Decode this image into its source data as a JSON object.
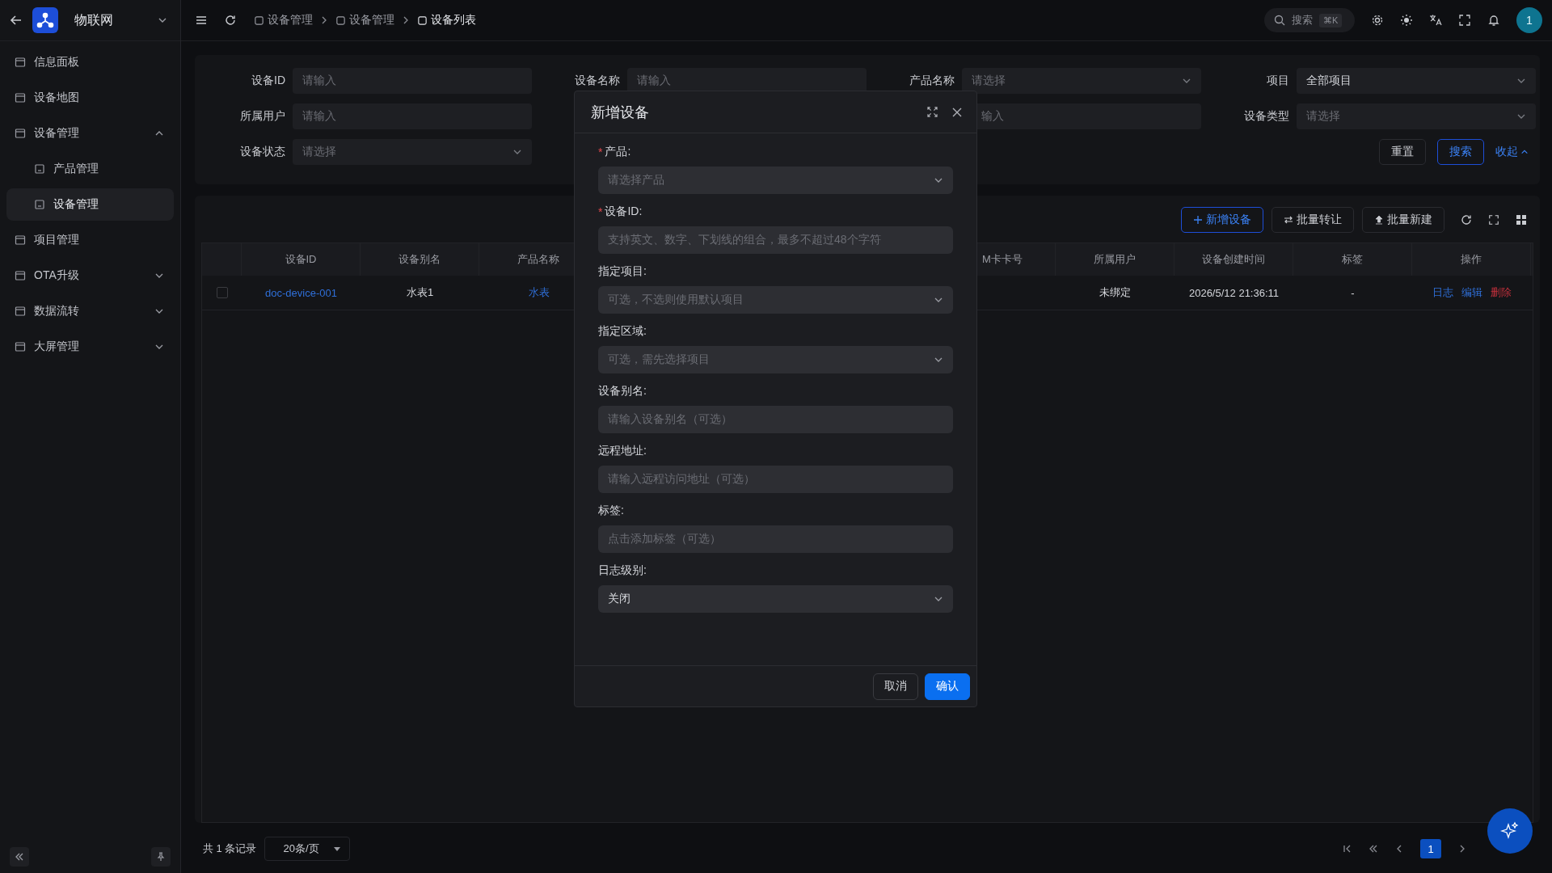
{
  "app": {
    "title": "物联网"
  },
  "breadcrumbs": [
    {
      "label": "设备管理"
    },
    {
      "label": "设备管理"
    },
    {
      "label": "设备列表"
    }
  ],
  "search": {
    "placeholder": "搜索",
    "shortcut": "⌘K"
  },
  "user": {
    "avatar": "1"
  },
  "sidebar": {
    "items": [
      {
        "label": "信息面板",
        "kind": "link",
        "selected": false
      },
      {
        "label": "设备地图",
        "kind": "link",
        "selected": false
      },
      {
        "label": "设备管理",
        "kind": "group",
        "expanded": true,
        "selected": false,
        "children": [
          {
            "label": "产品管理",
            "selected": false
          },
          {
            "label": "设备管理",
            "selected": true
          }
        ]
      },
      {
        "label": "项目管理",
        "kind": "link",
        "selected": false
      },
      {
        "label": "OTA升级",
        "kind": "group",
        "expanded": false,
        "selected": false
      },
      {
        "label": "数据流转",
        "kind": "group",
        "expanded": false,
        "selected": false
      },
      {
        "label": "大屏管理",
        "kind": "group",
        "expanded": false,
        "selected": false
      }
    ]
  },
  "filters": [
    {
      "kind": "input",
      "label": "设备ID",
      "placeholder": "请输入"
    },
    {
      "kind": "input",
      "label": "设备名称",
      "placeholder": "请输入"
    },
    {
      "kind": "select",
      "label": "产品名称",
      "placeholder": "请选择"
    },
    {
      "kind": "select",
      "label": "项目",
      "value": "全部项目"
    },
    {
      "kind": "input",
      "label": "所属用户",
      "placeholder": "请输入"
    },
    {
      "kind": "covered"
    },
    {
      "kind": "clipped",
      "placeholder": "输入"
    },
    {
      "kind": "select",
      "label": "设备类型",
      "placeholder": "请选择"
    },
    {
      "kind": "select",
      "label": "设备状态",
      "placeholder": "请选择"
    }
  ],
  "filter_actions": {
    "reset": "重置",
    "search": "搜索",
    "collapse": "收起"
  },
  "toolbar": [
    {
      "label": "新增设备",
      "kind": "primary"
    },
    {
      "label": "批量转让",
      "kind": "default"
    },
    {
      "label": "批量新建",
      "kind": "default"
    }
  ],
  "table": {
    "columns": [
      {
        "kind": "text",
        "label": "设备ID"
      },
      {
        "kind": "text",
        "label": "设备别名"
      },
      {
        "kind": "text",
        "label": "产品名称"
      },
      {
        "kind": "covered"
      },
      {
        "kind": "clipped",
        "label": "M卡卡号"
      },
      {
        "kind": "text",
        "label": "所属用户"
      },
      {
        "kind": "text",
        "label": "设备创建时间"
      },
      {
        "kind": "text",
        "label": "标签"
      },
      {
        "kind": "text",
        "label": "操作"
      }
    ],
    "rows": [
      {
        "checked": false,
        "cells": [
          {
            "kind": "link",
            "text": "doc-device-001"
          },
          {
            "kind": "text",
            "text": "水表1"
          },
          {
            "kind": "link",
            "text": "水表"
          },
          {
            "kind": "covered"
          },
          {
            "kind": "blank"
          },
          {
            "kind": "text",
            "text": "未绑定"
          },
          {
            "kind": "text",
            "text": "2026/5/12 21:36:11"
          },
          {
            "kind": "text",
            "text": "-"
          },
          {
            "kind": "actions",
            "actions": [
              {
                "label": "日志",
                "kind": "normal"
              },
              {
                "label": "编辑",
                "kind": "normal"
              },
              {
                "label": "删除",
                "kind": "danger"
              }
            ]
          }
        ]
      }
    ]
  },
  "footer": {
    "total": "共 1 条记录",
    "page_size": "20条/页",
    "pages": [
      {
        "label": "1",
        "selected": true
      }
    ]
  },
  "dialog": {
    "title": "新增设备",
    "fields": [
      {
        "required_mark": "*",
        "label": "产品:",
        "kind": "select",
        "placeholder": "请选择产品"
      },
      {
        "required_mark": "*",
        "label": "设备ID:",
        "kind": "input",
        "placeholder": "支持英文、数字、下划线的组合，最多不超过48个字符"
      },
      {
        "label": "指定项目:",
        "kind": "select",
        "placeholder": "可选，不选则使用默认项目"
      },
      {
        "label": "指定区域:",
        "kind": "select",
        "placeholder": "可选，需先选择项目"
      },
      {
        "label": "设备别名:",
        "kind": "input",
        "placeholder": "请输入设备别名（可选）"
      },
      {
        "label": "远程地址:",
        "kind": "input",
        "placeholder": "请输入远程访问地址（可选）"
      },
      {
        "label": "标签:",
        "kind": "input",
        "placeholder": "点击添加标签（可选）"
      },
      {
        "label": "日志级别:",
        "kind": "select",
        "value": "关闭"
      }
    ],
    "buttons": [
      {
        "label": "取消",
        "kind": "default"
      },
      {
        "label": "确认",
        "kind": "primary"
      }
    ]
  }
}
